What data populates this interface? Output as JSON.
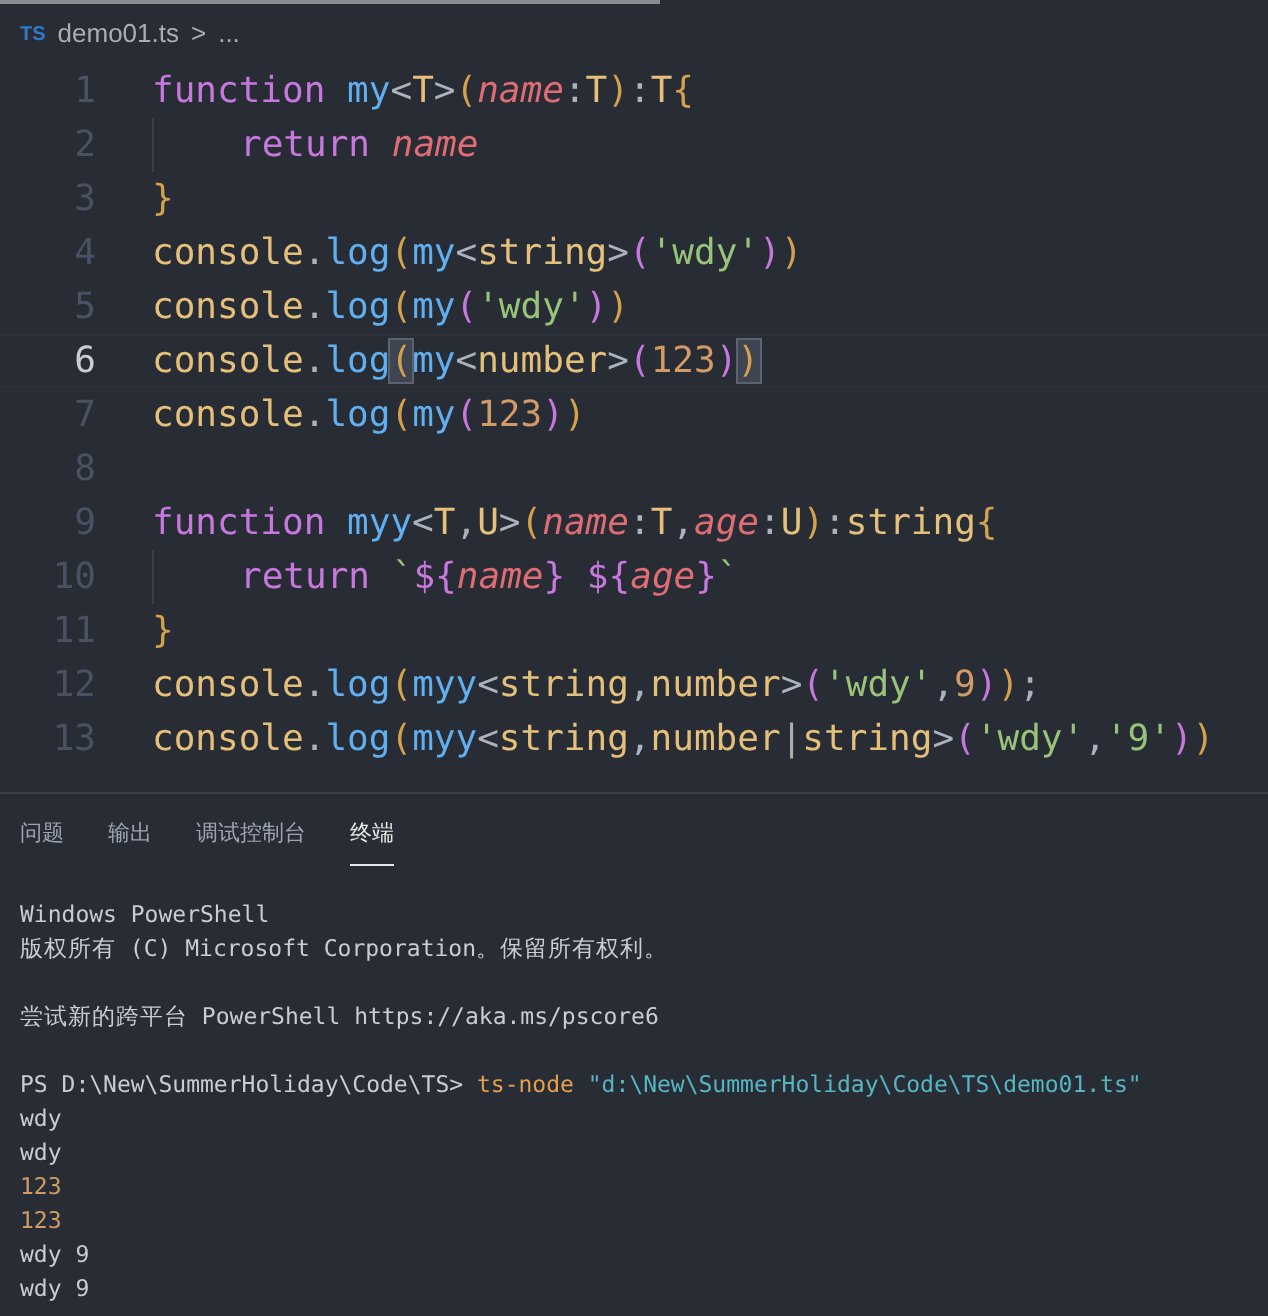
{
  "breadcrumb": {
    "badge": "TS",
    "file": "demo01.ts",
    "separator": ">",
    "more": "..."
  },
  "editor": {
    "lines": [
      {
        "number": "1",
        "current": false,
        "indent": false,
        "tokens": [
          {
            "kind": "keyword",
            "text": "function"
          },
          {
            "kind": "func",
            "text": "my",
            "gap": true
          },
          {
            "kind": "plain",
            "text": "<"
          },
          {
            "kind": "type",
            "text": "T"
          },
          {
            "kind": "plain",
            "text": ">"
          },
          {
            "kind": "b1",
            "text": "("
          },
          {
            "kind": "param",
            "text": "name"
          },
          {
            "kind": "plain",
            "text": ":"
          },
          {
            "kind": "type",
            "text": "T"
          },
          {
            "kind": "b1",
            "text": ")"
          },
          {
            "kind": "plain",
            "text": ":"
          },
          {
            "kind": "type",
            "text": "T"
          },
          {
            "kind": "b1",
            "text": "{"
          }
        ]
      },
      {
        "number": "2",
        "current": false,
        "indent": true,
        "tokens": [
          {
            "kind": "keyword",
            "text": "return"
          },
          {
            "kind": "param",
            "text": "name",
            "gap": true
          }
        ]
      },
      {
        "number": "3",
        "current": false,
        "indent": false,
        "tokens": [
          {
            "kind": "b1",
            "text": "}"
          }
        ]
      },
      {
        "number": "4",
        "current": false,
        "indent": false,
        "tokens": [
          {
            "kind": "type",
            "text": "console"
          },
          {
            "kind": "plain",
            "text": "."
          },
          {
            "kind": "func",
            "text": "log"
          },
          {
            "kind": "b1",
            "text": "("
          },
          {
            "kind": "func",
            "text": "my"
          },
          {
            "kind": "plain",
            "text": "<"
          },
          {
            "kind": "type",
            "text": "string"
          },
          {
            "kind": "plain",
            "text": ">"
          },
          {
            "kind": "b2",
            "text": "("
          },
          {
            "kind": "string",
            "text": "'wdy'"
          },
          {
            "kind": "b2",
            "text": ")"
          },
          {
            "kind": "b1",
            "text": ")"
          }
        ]
      },
      {
        "number": "5",
        "current": false,
        "indent": false,
        "tokens": [
          {
            "kind": "type",
            "text": "console"
          },
          {
            "kind": "plain",
            "text": "."
          },
          {
            "kind": "func",
            "text": "log"
          },
          {
            "kind": "b1",
            "text": "("
          },
          {
            "kind": "func",
            "text": "my"
          },
          {
            "kind": "b2",
            "text": "("
          },
          {
            "kind": "string",
            "text": "'wdy'"
          },
          {
            "kind": "b2",
            "text": ")"
          },
          {
            "kind": "b1",
            "text": ")"
          }
        ]
      },
      {
        "number": "6",
        "current": true,
        "indent": false,
        "tokens": [
          {
            "kind": "type",
            "text": "console"
          },
          {
            "kind": "plain",
            "text": "."
          },
          {
            "kind": "func",
            "text": "log"
          },
          {
            "kind": "match",
            "text": "("
          },
          {
            "kind": "func",
            "text": "my"
          },
          {
            "kind": "plain",
            "text": "<"
          },
          {
            "kind": "type",
            "text": "number"
          },
          {
            "kind": "plain",
            "text": ">"
          },
          {
            "kind": "b2",
            "text": "("
          },
          {
            "kind": "number",
            "text": "123"
          },
          {
            "kind": "b2",
            "text": ")"
          },
          {
            "kind": "match",
            "text": ")"
          }
        ]
      },
      {
        "number": "7",
        "current": false,
        "indent": false,
        "tokens": [
          {
            "kind": "type",
            "text": "console"
          },
          {
            "kind": "plain",
            "text": "."
          },
          {
            "kind": "func",
            "text": "log"
          },
          {
            "kind": "b1",
            "text": "("
          },
          {
            "kind": "func",
            "text": "my"
          },
          {
            "kind": "b2",
            "text": "("
          },
          {
            "kind": "number",
            "text": "123"
          },
          {
            "kind": "b2",
            "text": ")"
          },
          {
            "kind": "b1",
            "text": ")"
          }
        ]
      },
      {
        "number": "8",
        "current": false,
        "indent": false
      },
      {
        "number": "9",
        "current": false,
        "indent": false,
        "tokens": [
          {
            "kind": "keyword",
            "text": "function"
          },
          {
            "kind": "func",
            "text": "myy",
            "gap": true
          },
          {
            "kind": "plain",
            "text": "<"
          },
          {
            "kind": "type",
            "text": "T"
          },
          {
            "kind": "plain",
            "text": ","
          },
          {
            "kind": "type",
            "text": "U"
          },
          {
            "kind": "plain",
            "text": ">"
          },
          {
            "kind": "b1",
            "text": "("
          },
          {
            "kind": "param",
            "text": "name"
          },
          {
            "kind": "plain",
            "text": ":"
          },
          {
            "kind": "type",
            "text": "T"
          },
          {
            "kind": "plain",
            "text": ","
          },
          {
            "kind": "param",
            "text": "age"
          },
          {
            "kind": "plain",
            "text": ":"
          },
          {
            "kind": "type",
            "text": "U"
          },
          {
            "kind": "b1",
            "text": ")"
          },
          {
            "kind": "plain",
            "text": ":"
          },
          {
            "kind": "type",
            "text": "string"
          },
          {
            "kind": "b1",
            "text": "{"
          }
        ]
      },
      {
        "number": "10",
        "current": false,
        "indent": true,
        "tokens": [
          {
            "kind": "keyword",
            "text": "return"
          },
          {
            "kind": "string",
            "text": "`",
            "gap": true
          },
          {
            "kind": "keyword",
            "text": "${"
          },
          {
            "kind": "param",
            "text": "name"
          },
          {
            "kind": "keyword",
            "text": "}"
          },
          {
            "kind": "keyword",
            "text": "${",
            "gap": true
          },
          {
            "kind": "param",
            "text": "age"
          },
          {
            "kind": "keyword",
            "text": "}"
          },
          {
            "kind": "string",
            "text": "`"
          }
        ]
      },
      {
        "number": "11",
        "current": false,
        "indent": false,
        "tokens": [
          {
            "kind": "b1",
            "text": "}"
          }
        ]
      },
      {
        "number": "12",
        "current": false,
        "indent": false,
        "tokens": [
          {
            "kind": "type",
            "text": "console"
          },
          {
            "kind": "plain",
            "text": "."
          },
          {
            "kind": "func",
            "text": "log"
          },
          {
            "kind": "b1",
            "text": "("
          },
          {
            "kind": "func",
            "text": "myy"
          },
          {
            "kind": "plain",
            "text": "<"
          },
          {
            "kind": "type",
            "text": "string"
          },
          {
            "kind": "plain",
            "text": ","
          },
          {
            "kind": "type",
            "text": "number"
          },
          {
            "kind": "plain",
            "text": ">"
          },
          {
            "kind": "b2",
            "text": "("
          },
          {
            "kind": "string",
            "text": "'wdy'"
          },
          {
            "kind": "plain",
            "text": ","
          },
          {
            "kind": "number",
            "text": "9"
          },
          {
            "kind": "b2",
            "text": ")"
          },
          {
            "kind": "b1",
            "text": ")"
          },
          {
            "kind": "plain",
            "text": ";"
          }
        ]
      },
      {
        "number": "13",
        "current": false,
        "indent": false,
        "tokens": [
          {
            "kind": "type",
            "text": "console"
          },
          {
            "kind": "plain",
            "text": "."
          },
          {
            "kind": "func",
            "text": "log"
          },
          {
            "kind": "b1",
            "text": "("
          },
          {
            "kind": "func",
            "text": "myy"
          },
          {
            "kind": "plain",
            "text": "<"
          },
          {
            "kind": "type",
            "text": "string"
          },
          {
            "kind": "plain",
            "text": ","
          },
          {
            "kind": "type",
            "text": "number"
          },
          {
            "kind": "cursor",
            "text": "|"
          },
          {
            "kind": "type",
            "text": "string"
          },
          {
            "kind": "plain",
            "text": ">"
          },
          {
            "kind": "b2",
            "text": "("
          },
          {
            "kind": "string",
            "text": "'wdy'"
          },
          {
            "kind": "plain",
            "text": ","
          },
          {
            "kind": "string",
            "text": "'9'"
          },
          {
            "kind": "b2",
            "text": ")"
          },
          {
            "kind": "b1",
            "text": ")"
          }
        ]
      }
    ]
  },
  "panel": {
    "tabs": [
      {
        "label": "问题",
        "selected": false
      },
      {
        "label": "输出",
        "selected": false
      },
      {
        "label": "调试控制台",
        "selected": false
      },
      {
        "label": "终端",
        "selected": true
      }
    ],
    "terminal": [
      {
        "blank_before": false,
        "segments": [
          {
            "kind": "plain",
            "text": "Windows PowerShell"
          }
        ]
      },
      {
        "blank_before": false,
        "segments": [
          {
            "kind": "plain",
            "text": "版权所有 (C) Microsoft Corporation。保留所有权利。"
          }
        ]
      },
      {
        "blank_before": true,
        "segments": [
          {
            "kind": "plain",
            "text": "尝试新的跨平台 PowerShell https://aka.ms/pscore6"
          }
        ]
      },
      {
        "blank_before": true,
        "segments": [
          {
            "kind": "plain",
            "text": "PS D:\\New\\SummerHoliday\\Code\\TS>"
          },
          {
            "kind": "command",
            "text": "ts-node",
            "gap": true
          },
          {
            "kind": "string",
            "text": "\"d:\\New\\SummerHoliday\\Code\\TS\\demo01.ts\"",
            "gap": true
          }
        ]
      },
      {
        "blank_before": false,
        "segments": [
          {
            "kind": "plain",
            "text": "wdy"
          }
        ]
      },
      {
        "blank_before": false,
        "segments": [
          {
            "kind": "plain",
            "text": "wdy"
          }
        ]
      },
      {
        "blank_before": false,
        "segments": [
          {
            "kind": "number",
            "text": "123"
          }
        ]
      },
      {
        "blank_before": false,
        "segments": [
          {
            "kind": "number",
            "text": "123"
          }
        ]
      },
      {
        "blank_before": false,
        "segments": [
          {
            "kind": "plain",
            "text": "wdy 9"
          }
        ]
      },
      {
        "blank_before": false,
        "segments": [
          {
            "kind": "plain",
            "text": "wdy 9"
          }
        ]
      }
    ]
  }
}
